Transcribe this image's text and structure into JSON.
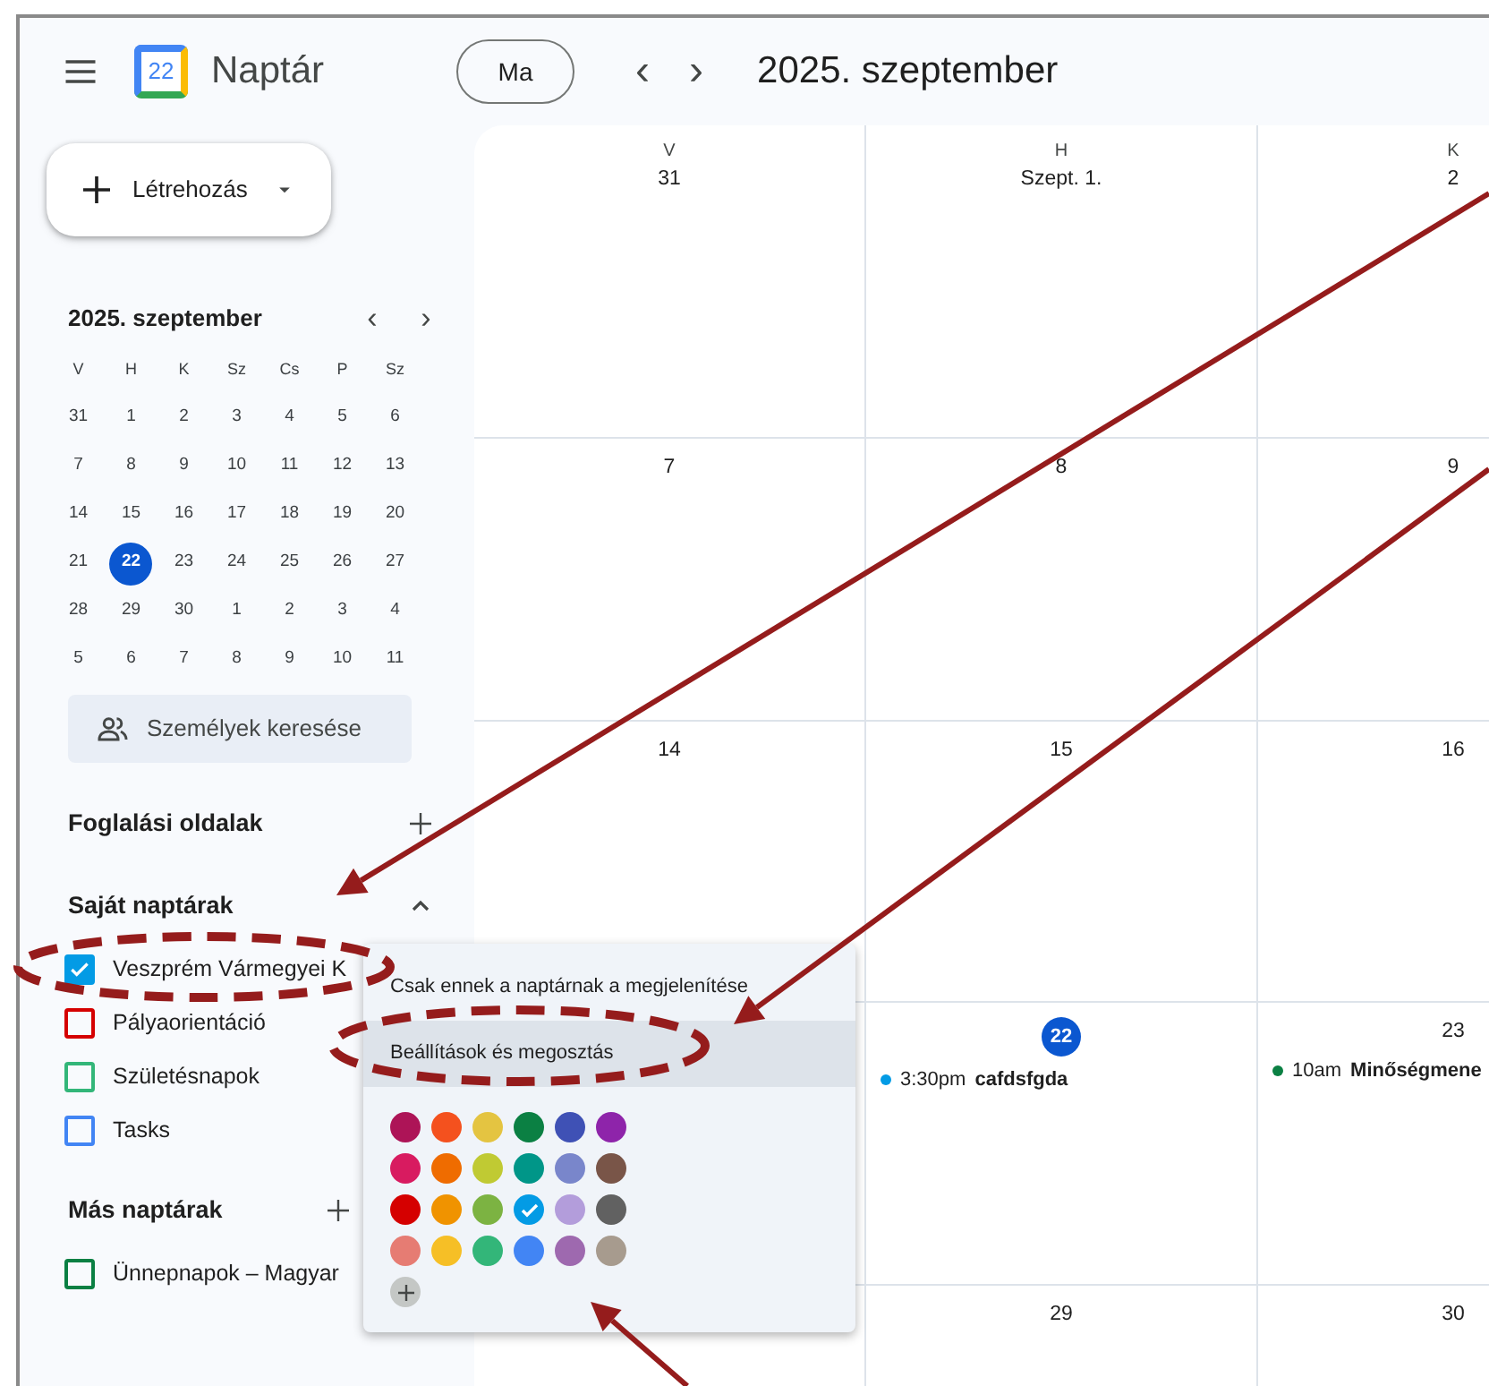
{
  "header": {
    "app_name": "Naptár",
    "logo_text": "22",
    "today_button": "Ma",
    "prev": "‹",
    "next": "›",
    "title": "2025. szeptember"
  },
  "sidebar": {
    "create_button": "Létrehozás",
    "mini_calendar": {
      "title": "2025. szeptember",
      "weekdays": [
        "V",
        "H",
        "K",
        "Sz",
        "Cs",
        "P",
        "Sz"
      ],
      "weeks": [
        [
          {
            "d": "31",
            "selected": false
          },
          {
            "d": "1",
            "selected": false
          },
          {
            "d": "2",
            "selected": false
          },
          {
            "d": "3",
            "selected": false
          },
          {
            "d": "4",
            "selected": false
          },
          {
            "d": "5",
            "selected": false
          },
          {
            "d": "6",
            "selected": false
          }
        ],
        [
          {
            "d": "7",
            "selected": false
          },
          {
            "d": "8",
            "selected": false
          },
          {
            "d": "9",
            "selected": false
          },
          {
            "d": "10",
            "selected": false
          },
          {
            "d": "11",
            "selected": false
          },
          {
            "d": "12",
            "selected": false
          },
          {
            "d": "13",
            "selected": false
          }
        ],
        [
          {
            "d": "14",
            "selected": false
          },
          {
            "d": "15",
            "selected": false
          },
          {
            "d": "16",
            "selected": false
          },
          {
            "d": "17",
            "selected": false
          },
          {
            "d": "18",
            "selected": false
          },
          {
            "d": "19",
            "selected": false
          },
          {
            "d": "20",
            "selected": false
          }
        ],
        [
          {
            "d": "21",
            "selected": false
          },
          {
            "d": "22",
            "selected": true
          },
          {
            "d": "23",
            "selected": false
          },
          {
            "d": "24",
            "selected": false
          },
          {
            "d": "25",
            "selected": false
          },
          {
            "d": "26",
            "selected": false
          },
          {
            "d": "27",
            "selected": false
          }
        ],
        [
          {
            "d": "28",
            "selected": false
          },
          {
            "d": "29",
            "selected": false
          },
          {
            "d": "30",
            "selected": false
          },
          {
            "d": "1",
            "selected": false
          },
          {
            "d": "2",
            "selected": false
          },
          {
            "d": "3",
            "selected": false
          },
          {
            "d": "4",
            "selected": false
          }
        ],
        [
          {
            "d": "5",
            "selected": false
          },
          {
            "d": "6",
            "selected": false
          },
          {
            "d": "7",
            "selected": false
          },
          {
            "d": "8",
            "selected": false
          },
          {
            "d": "9",
            "selected": false
          },
          {
            "d": "10",
            "selected": false
          },
          {
            "d": "11",
            "selected": false
          }
        ]
      ]
    },
    "people_search": {
      "placeholder": "Személyek keresése"
    },
    "sections": [
      {
        "title": "Foglalási oldalak",
        "kind": "add"
      },
      {
        "title": "Saját naptárak",
        "kind": "collapse",
        "expanded": true,
        "items": [
          {
            "label": "Veszprém Vármegyei K",
            "color": "#039be5",
            "checked": true
          },
          {
            "label": "Pályaorientáció",
            "color": "#d50000",
            "checked": false
          },
          {
            "label": "Születésnapok",
            "color": "#33b679",
            "checked": false
          },
          {
            "label": "Tasks",
            "color": "#4285f4",
            "checked": false
          }
        ]
      },
      {
        "title": "Más naptárak",
        "kind": "add",
        "items": [
          {
            "label": "Ünnepnapok – Magyar",
            "color": "#0b8043",
            "checked": false
          }
        ]
      }
    ]
  },
  "month_grid": {
    "weeks": [
      [
        {
          "kind": "day",
          "weekday": "V",
          "date": "31"
        },
        {
          "kind": "day",
          "weekday": "H",
          "date": "Szept. 1."
        },
        {
          "kind": "day",
          "weekday": "K",
          "date": "2"
        }
      ],
      [
        {
          "kind": "day",
          "date": "7"
        },
        {
          "kind": "day",
          "date": "8"
        },
        {
          "kind": "day",
          "date": "9"
        }
      ],
      [
        {
          "kind": "day",
          "date": "14"
        },
        {
          "kind": "day",
          "date": "15"
        },
        {
          "kind": "day",
          "date": "16"
        }
      ],
      [
        {
          "kind": "covered"
        },
        {
          "kind": "today",
          "date": "22",
          "events": [
            {
              "time": "3:30pm",
              "title": "cafdsfgda",
              "color": "#039be5"
            }
          ]
        },
        {
          "kind": "day",
          "date": "23",
          "events": [
            {
              "time": "10am",
              "title": "Minőségmene",
              "color": "#0b8043"
            }
          ]
        }
      ],
      [
        {
          "kind": "covered"
        },
        {
          "kind": "day",
          "date": "29"
        },
        {
          "kind": "day",
          "date": "30"
        }
      ]
    ]
  },
  "context_menu": {
    "items": [
      {
        "label": "Csak ennek a naptárnak a megjelenítése",
        "selected": false
      },
      {
        "label": "Beállítások és megosztás",
        "selected": true
      }
    ],
    "colors": [
      [
        {
          "color": "#ad1457",
          "selected": false
        },
        {
          "color": "#f4511e",
          "selected": false
        },
        {
          "color": "#e4c441",
          "selected": false
        },
        {
          "color": "#0b8043",
          "selected": false
        },
        {
          "color": "#3f51b5",
          "selected": false
        },
        {
          "color": "#8e24aa",
          "selected": false
        }
      ],
      [
        {
          "color": "#d81b60",
          "selected": false
        },
        {
          "color": "#ef6c00",
          "selected": false
        },
        {
          "color": "#c0ca33",
          "selected": false
        },
        {
          "color": "#009688",
          "selected": false
        },
        {
          "color": "#7986cb",
          "selected": false
        },
        {
          "color": "#795548",
          "selected": false
        }
      ],
      [
        {
          "color": "#d50000",
          "selected": false
        },
        {
          "color": "#f09300",
          "selected": false
        },
        {
          "color": "#7cb342",
          "selected": false
        },
        {
          "color": "#039be5",
          "selected": true
        },
        {
          "color": "#b39ddb",
          "selected": false
        },
        {
          "color": "#616161",
          "selected": false
        }
      ],
      [
        {
          "color": "#e67c73",
          "selected": false
        },
        {
          "color": "#f6bf26",
          "selected": false
        },
        {
          "color": "#33b679",
          "selected": false
        },
        {
          "color": "#4285f4",
          "selected": false
        },
        {
          "color": "#9e69af",
          "selected": false
        },
        {
          "color": "#a79b8e",
          "selected": false
        }
      ]
    ],
    "add_color": true
  },
  "annotations": [
    {
      "kind": "ellipse"
    },
    {
      "kind": "ellipse"
    },
    {
      "kind": "arrow"
    },
    {
      "kind": "arrow"
    },
    {
      "kind": "arrow"
    }
  ]
}
